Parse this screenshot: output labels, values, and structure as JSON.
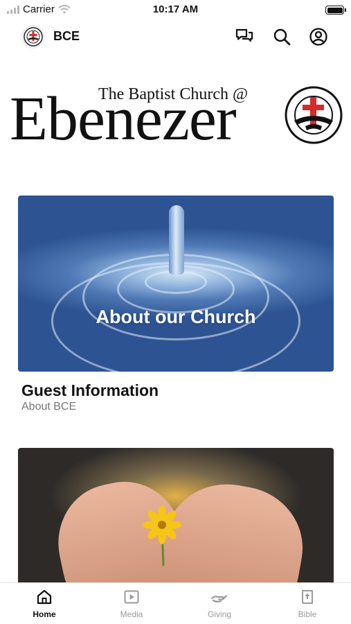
{
  "status_bar": {
    "carrier": "Carrier",
    "time": "10:17 AM"
  },
  "header": {
    "title": "BCE",
    "icons": [
      "chat-icon",
      "search-icon",
      "account-icon"
    ]
  },
  "banner": {
    "subtitle": "The Baptist Church @",
    "title": "Ebenezer"
  },
  "cards": [
    {
      "image_text": "About our Church",
      "title": "Guest Information",
      "subtitle": "About BCE"
    },
    {
      "image_text": ""
    }
  ],
  "tabs": [
    {
      "label": "Home",
      "icon": "home-icon",
      "active": true
    },
    {
      "label": "Media",
      "icon": "media-icon",
      "active": false
    },
    {
      "label": "Giving",
      "icon": "giving-icon",
      "active": false
    },
    {
      "label": "Bible",
      "icon": "bible-icon",
      "active": false
    }
  ],
  "colors": {
    "accent": "#111111",
    "inactive": "#9a9a9a",
    "seal_red": "#d62b2b"
  }
}
